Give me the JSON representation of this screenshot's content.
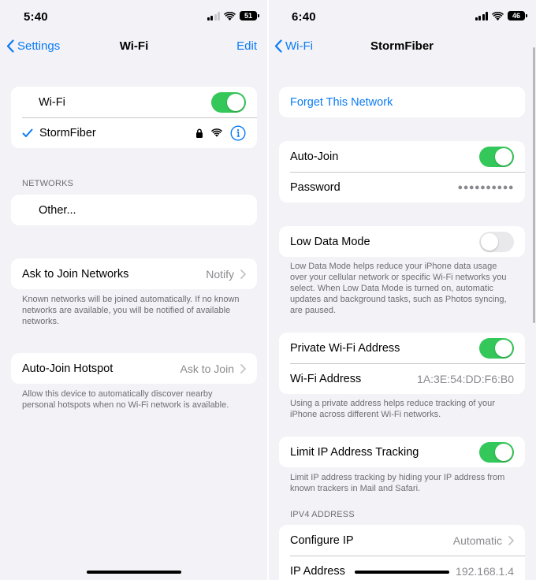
{
  "left": {
    "status": {
      "time": "5:40",
      "battery": "51"
    },
    "nav": {
      "back": "Settings",
      "title": "Wi-Fi",
      "right": "Edit"
    },
    "wifi_row": {
      "label": "Wi-Fi",
      "on": true
    },
    "connected": {
      "name": "StormFiber"
    },
    "networks_header": "NETWORKS",
    "other_row": "Other...",
    "ask_join": {
      "label": "Ask to Join Networks",
      "value": "Notify"
    },
    "ask_join_note": "Known networks will be joined automatically. If no known networks are available, you will be notified of available networks.",
    "hotspot": {
      "label": "Auto-Join Hotspot",
      "value": "Ask to Join"
    },
    "hotspot_note": "Allow this device to automatically discover nearby personal hotspots when no Wi-Fi network is available."
  },
  "right": {
    "status": {
      "time": "6:40",
      "battery": "46"
    },
    "nav": {
      "back": "Wi-Fi",
      "title": "StormFiber"
    },
    "forget": "Forget This Network",
    "auto_join": {
      "label": "Auto-Join",
      "on": true
    },
    "password": {
      "label": "Password",
      "value": "●●●●●●●●●●"
    },
    "low_data": {
      "label": "Low Data Mode",
      "on": false
    },
    "low_data_note": "Low Data Mode helps reduce your iPhone data usage over your cellular network or specific Wi-Fi networks you select. When Low Data Mode is turned on, automatic updates and background tasks, such as Photos syncing, are paused.",
    "private_addr": {
      "label": "Private Wi-Fi Address",
      "on": true
    },
    "wifi_addr": {
      "label": "Wi-Fi Address",
      "value": "1A:3E:54:DD:F6:B0"
    },
    "private_note": "Using a private address helps reduce tracking of your iPhone across different Wi-Fi networks.",
    "limit_ip": {
      "label": "Limit IP Address Tracking",
      "on": true
    },
    "limit_note": "Limit IP address tracking by hiding your IP address from known trackers in Mail and Safari.",
    "ipv4_header": "IPV4 ADDRESS",
    "configure_ip": {
      "label": "Configure IP",
      "value": "Automatic"
    },
    "ip_address": {
      "label": "IP Address",
      "value": "192.168.1.4"
    }
  },
  "colors": {
    "accent": "#0a7bf5",
    "toggle_on": "#34c759",
    "toggle_off": "#e9e9eb",
    "background": "#f2f2f7"
  },
  "icons": [
    "back-chevron-icon",
    "checkmark-icon",
    "lock-icon",
    "wifi-icon",
    "info-icon",
    "disclosure-chevron-icon",
    "cellular-signal-icon",
    "battery-icon"
  ]
}
